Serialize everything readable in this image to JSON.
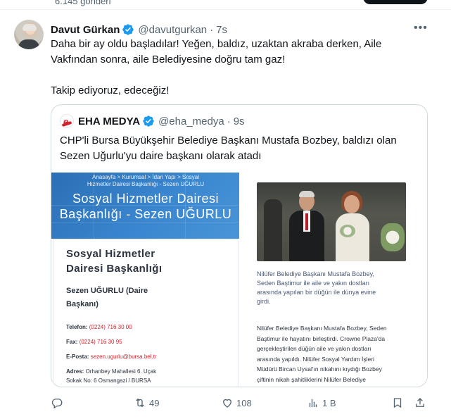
{
  "top": {
    "post_count": "6.145 gönderi"
  },
  "tweet": {
    "author_name": "Davut Gürkan",
    "author_handle": "@davutgurkan",
    "separator": "·",
    "time": "7s",
    "more_glyph": "•••",
    "text_line1": "Daha bir ay oldu başladılar! Yeğen, baldız, uzaktan akraba derken, Aile",
    "text_line2": "Vakfından sonra, aile Belediyesine doğru tam gaz!",
    "text_line3": "Takip ediyoruz, edeceğiz!"
  },
  "quote": {
    "author_name": "EHA MEDYA",
    "author_handle": "@eha_medya",
    "separator": "·",
    "time": "9s",
    "logo_letter": "e",
    "text_line1": "CHP'li Bursa Büyükşehir Belediye Başkanı Mustafa Bozbey, baldızı olan",
    "text_line2": "Sezen Uğurlu'yu daire başkanı olarak atadı"
  },
  "left_image": {
    "breadcrumb1": "Anasayfa  >  Kurumsal  >  İdari Yapı  >  Sosyal",
    "breadcrumb2": "Hizmetler Dairesi Başkanlığı - Sezen UĞURLU",
    "banner_title_1": "Sosyal Hizmetler Dairesi",
    "banner_title_2": "Başkanlığı - Sezen UĞURLU",
    "panel_title_1": "Sosyal Hizmetler",
    "panel_title_2": "Dairesi Başkanlığı",
    "name_line1": "Sezen UĞURLU (Daire",
    "name_line2": "Başkanı)",
    "telefon_label": "Telefon:",
    "telefon_value": "(0224) 716 30 00",
    "fax_label": "Fax:",
    "fax_value": "(0224) 716 30 95",
    "email_label": "E-Posta:",
    "email_value": "sezen.ugurlu@bursa.bel.tr",
    "adres_label": "Adres:",
    "adres_value": "Orhanbey Mahallesi 6. Uçak",
    "adres_line2": "Sokak No: 6 Osmangazi / BURSA"
  },
  "right_image": {
    "caption_1": "Nilüfer Belediye Başkanı Mustafa Bozbey,",
    "caption_2": "Seden Baştimur ile aile ve yakın dostları",
    "caption_3": "arasında yapılan bir düğün ile dünya evine",
    "caption_4": "girdi.",
    "body_1": "Nilüfer Belediye Başkanı Mustafa Bozbey, Seden",
    "body_2": "Baştimur ile hayatını birleştirdi. Crowne Plaza'da",
    "body_3": "gerçekleştirilen düğün aile ve yakın dostları",
    "body_4": "arasında yapıldı. Nilüfer Sosyal Yardım İşleri",
    "body_5": "Müdürü Bircan Uysal'ın nikahını kıydığı Bozbey",
    "body_6": "çiftinin nikah şahitliklerini Nilüfer Belediye"
  },
  "actions": {
    "retweets": "49",
    "likes": "108",
    "views": "1 B"
  },
  "colors": {
    "verified": "#1d9bf0",
    "text_secondary": "#536471",
    "border": "#cfd9de",
    "banner_blue": "#3a86cf",
    "eha_red": "#d4202a"
  }
}
